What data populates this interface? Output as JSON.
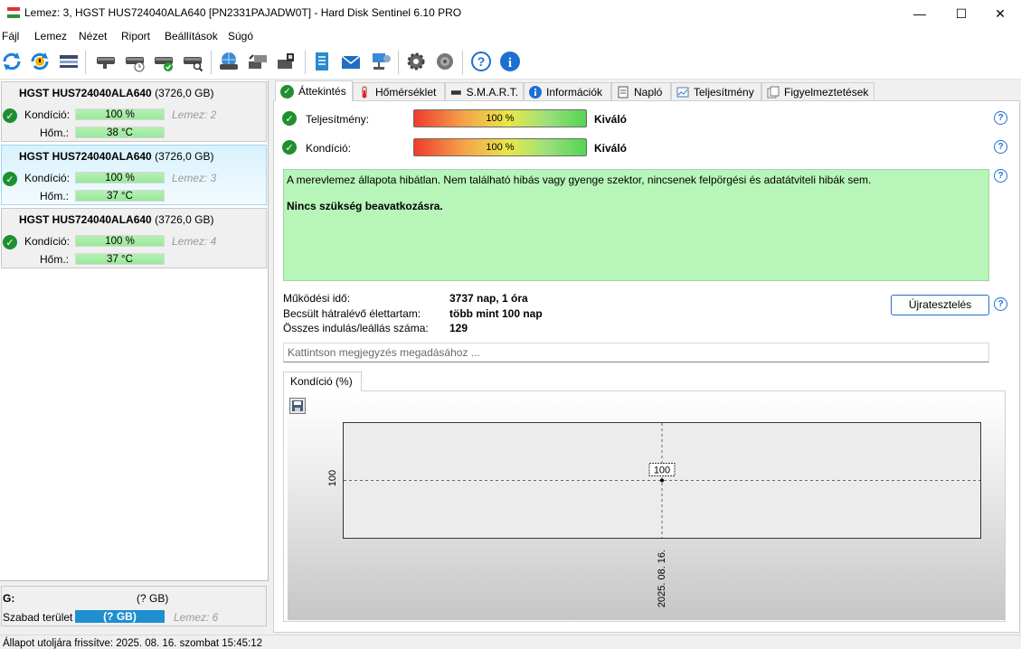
{
  "window": {
    "title": "Lemez: 3, HGST HUS724040ALA640 [PN2331PAJADW0T]  -  Hard Disk Sentinel 6.10 PRO",
    "minimize": "—",
    "maximize": "☐",
    "close": "✕"
  },
  "menu": [
    "Fájl",
    "Lemez",
    "Nézet",
    "Riport",
    "Beállítások",
    "Súgó"
  ],
  "toolbar_icons": [
    "refresh-icon",
    "refresh-warning-icon",
    "disk-list-icon",
    "disk-icon",
    "disk-clock-icon",
    "disk-check-icon",
    "disk-search-icon",
    "disk-globe-icon",
    "disk-transfer-icon",
    "disk-arrow-icon",
    "report-icon",
    "mail-icon",
    "network-icon",
    "settings-gear-icon",
    "sound-icon",
    "help-icon",
    "info-icon"
  ],
  "disks": [
    {
      "name": "HGST HUS724040ALA640",
      "size": "(3726,0 GB)",
      "condition_label": "Kondíció:",
      "condition_value": "100 %",
      "condition_pct": 100,
      "disk_ref": "Lemez: 2",
      "temp_label": "Hőm.:",
      "temp_value": "38 °C"
    },
    {
      "name": "HGST HUS724040ALA640",
      "size": "(3726,0 GB)",
      "condition_label": "Kondíció:",
      "condition_value": "100 %",
      "condition_pct": 100,
      "disk_ref": "Lemez: 3",
      "temp_label": "Hőm.:",
      "temp_value": "37 °C",
      "selected": true
    },
    {
      "name": "HGST HUS724040ALA640",
      "size": "(3726,0 GB)",
      "condition_label": "Kondíció:",
      "condition_value": "100 %",
      "condition_pct": 100,
      "disk_ref": "Lemez: 4",
      "temp_label": "Hőm.:",
      "temp_value": "37 °C"
    }
  ],
  "volume": {
    "drive": "G:",
    "size": "(? GB)",
    "free_label": "Szabad terület",
    "free_value": "(? GB)",
    "disk_ref": "Lemez: 6"
  },
  "statusbar": "Állapot utoljára frissítve: 2025. 08. 16. szombat 15:45:12",
  "tabs": [
    {
      "label": "Áttekintés",
      "icon": "check-circle-icon",
      "active": true
    },
    {
      "label": "Hőmérséklet",
      "icon": "thermometer-icon"
    },
    {
      "label": "S.M.A.R.T.",
      "icon": "smart-drive-icon"
    },
    {
      "label": "Információk",
      "icon": "info-icon"
    },
    {
      "label": "Napló",
      "icon": "log-page-icon"
    },
    {
      "label": "Teljesítmény",
      "icon": "performance-chart-icon"
    },
    {
      "label": "Figyelmeztetések",
      "icon": "alerts-icon"
    }
  ],
  "overview": {
    "performance_label": "Teljesítmény:",
    "performance_value": "100 %",
    "performance_pct": 100,
    "performance_rating": "Kiváló",
    "condition_label": "Kondíció:",
    "condition_value": "100 %",
    "condition_pct": 100,
    "condition_rating": "Kiváló",
    "status_line1": "A merevlemez állapota hibátlan. Nem található hibás vagy gyenge szektor, nincsenek felpörgési és adatátviteli hibák sem.",
    "status_line2": "Nincs szükség beavatkozásra.",
    "uptime_label": "Működési idő:",
    "uptime_value": "3737 nap, 1 óra",
    "lifetime_label": "Becsült hátralévő élettartam:",
    "lifetime_value": "több mint 100 nap",
    "startstop_label": "Összes indulás/leállás száma:",
    "startstop_value": "129",
    "retest_button": "Újratesztelés",
    "note_placeholder": "Kattintson megjegyzés megadásához ...",
    "chart_tab": "Kondíció  (%)"
  },
  "chart_data": {
    "type": "line",
    "x": [
      "2025. 08. 16."
    ],
    "series": [
      {
        "values": [
          100
        ]
      }
    ],
    "data_labels": [
      "100"
    ],
    "y_tick_labels": [
      "100"
    ],
    "x_tick_labels": [
      "2025. 08. 16."
    ],
    "grid": true
  }
}
